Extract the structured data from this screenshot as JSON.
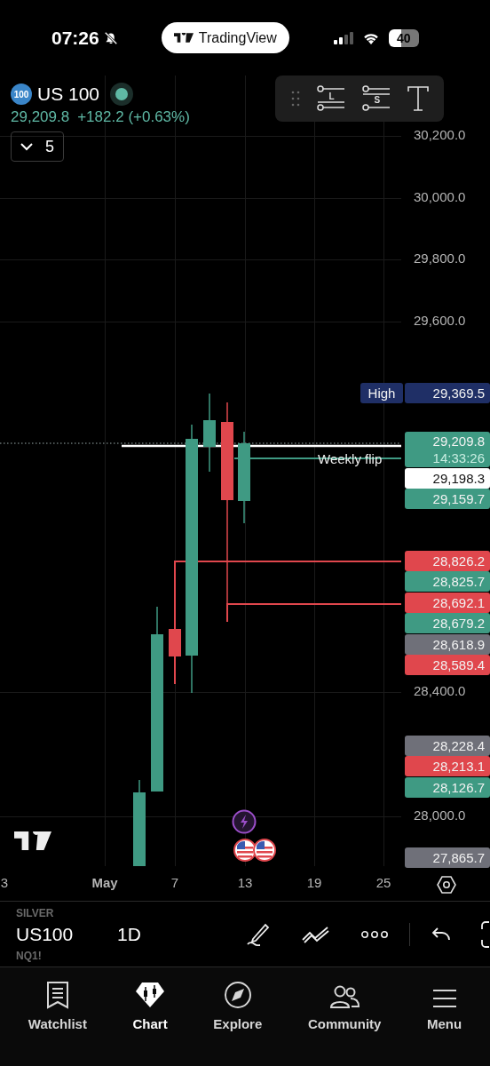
{
  "status_bar": {
    "time": "07:26",
    "battery": "40"
  },
  "app_pill": {
    "label": "TradingView"
  },
  "symbol": {
    "badge": "100",
    "name": "US 100",
    "price": "29,209.8",
    "change": "+182.2 (+0.63%)",
    "indicators_count": "5"
  },
  "drawing_toolbar": {
    "tools": [
      {
        "kind": "long-position",
        "label": "L"
      },
      {
        "kind": "short-position",
        "label": "S"
      },
      {
        "kind": "text"
      }
    ]
  },
  "chart": {
    "y_ticks": [
      "30,200.0",
      "30,000.0",
      "29,800.0",
      "29,600.0",
      "28,400.0",
      "28,000.0"
    ],
    "annotation": "Weekly flip",
    "price_labels": [
      [
        {
          "kind": "high",
          "title": "High",
          "text": "29,369.5",
          "color": "#1f2f66"
        }
      ],
      [
        {
          "kind": "timer",
          "text": "29,209.8",
          "sub": "14:33:26",
          "color": "#3f9a83"
        },
        {
          "kind": "price",
          "text": "29,198.3",
          "color": "#ffffff"
        },
        {
          "kind": "price",
          "text": "29,159.7",
          "color": "#3f9a83"
        }
      ],
      [
        {
          "kind": "price",
          "text": "28,826.2",
          "color": "#e0474d"
        },
        {
          "kind": "price",
          "text": "28,825.7",
          "color": "#3f9a83"
        },
        {
          "kind": "price",
          "text": "28,692.1",
          "color": "#e0474d"
        },
        {
          "kind": "price",
          "text": "28,679.2",
          "color": "#3f9a83"
        },
        {
          "kind": "price",
          "text": "28,618.9",
          "color": "#6f7079"
        },
        {
          "kind": "price",
          "text": "28,589.4",
          "color": "#e0474d"
        }
      ],
      [
        {
          "kind": "price",
          "text": "28,228.4",
          "color": "#6f7079"
        },
        {
          "kind": "price",
          "text": "28,213.1",
          "color": "#e0474d"
        },
        {
          "kind": "price",
          "text": "28,126.7",
          "color": "#3f9a83"
        }
      ],
      [
        {
          "kind": "price",
          "text": "27,865.7",
          "color": "#6f7079"
        }
      ]
    ],
    "x_ticks": [
      {
        "label": "3",
        "bold": false
      },
      {
        "label": "May",
        "bold": true
      },
      {
        "label": "7",
        "bold": false
      },
      {
        "label": "13",
        "bold": false
      },
      {
        "label": "19",
        "bold": false
      },
      {
        "label": "25",
        "bold": false
      }
    ]
  },
  "bottom_toolbar": {
    "symbols": [
      {
        "label": "SILVER",
        "selected": false
      },
      {
        "label": "US100",
        "selected": true
      },
      {
        "label": "NQ1!",
        "selected": false
      }
    ],
    "interval": "1D"
  },
  "tab_bar": [
    {
      "kind": "watchlist",
      "label": "Watchlist",
      "selected": false
    },
    {
      "kind": "chart",
      "label": "Chart",
      "selected": true
    },
    {
      "kind": "explore",
      "label": "Explore",
      "selected": false
    },
    {
      "kind": "community",
      "label": "Community",
      "selected": false
    },
    {
      "kind": "menu",
      "label": "Menu",
      "selected": false
    }
  ]
}
